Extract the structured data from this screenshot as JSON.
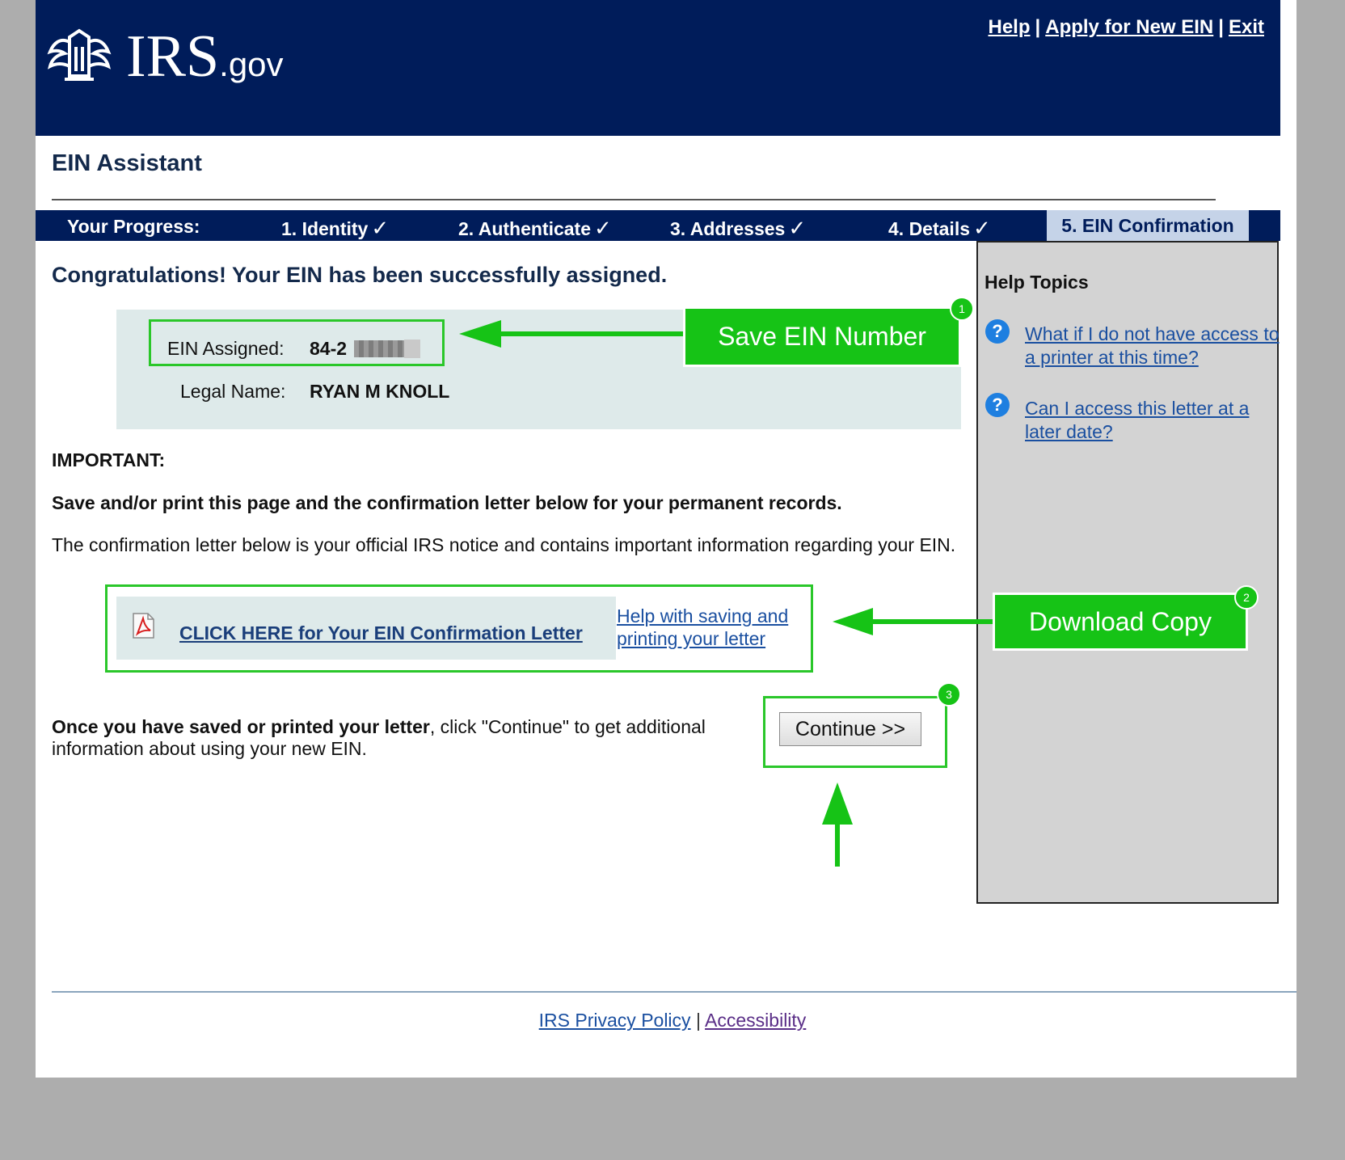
{
  "header": {
    "logo_text": "IRS",
    "logo_suffix": ".gov",
    "links": {
      "help": "Help",
      "apply": "Apply for New EIN",
      "exit": "Exit",
      "separator": "|"
    }
  },
  "app_title": "EIN Assistant",
  "progress": {
    "label": "Your Progress:",
    "steps": [
      {
        "label": "1. Identity",
        "done": true
      },
      {
        "label": "2. Authenticate",
        "done": true
      },
      {
        "label": "3. Addresses",
        "done": true
      },
      {
        "label": "4. Details",
        "done": true
      },
      {
        "label": "5. EIN Confirmation",
        "current": true
      }
    ],
    "check_glyph": "✓"
  },
  "main": {
    "congrats": "Congratulations! Your EIN has been successfully assigned.",
    "ein_label": "EIN Assigned:",
    "ein_value": "84-2",
    "legal_name_label": "Legal Name:",
    "legal_name_value": "RYAN M KNOLL",
    "important": "IMPORTANT:",
    "save_note": "Save and/or print this page and the confirmation letter below for your permanent records.",
    "letter_note": "The confirmation letter below is your official IRS notice and contains important information regarding your EIN.",
    "pdf_link": "CLICK HERE for Your EIN Confirmation Letter",
    "help_saving_link": "Help with saving and printing your letter",
    "continue_bold": "Once you have saved or printed your letter",
    "continue_rest": ", click \"Continue\" to get additional information about using your new EIN.",
    "continue_button": "Continue >>"
  },
  "sidebar": {
    "title": "Help Topics",
    "links": [
      "What if I do not have access to a printer at this time?",
      "Can I access this letter at a later date?"
    ],
    "icon_glyph": "?"
  },
  "annotations": {
    "callout1": "Save EIN Number",
    "callout2": "Download Copy",
    "badge1": "1",
    "badge2": "2",
    "badge3": "3",
    "color": "#16c316"
  },
  "footer": {
    "privacy": "IRS Privacy Policy",
    "separator": "|",
    "accessibility": "Accessibility"
  },
  "colors": {
    "navy": "#001c5a",
    "progress_current_bg": "#c5d3e8",
    "sidebar_bg": "#d3d3d3",
    "info_box_bg": "#deeaea"
  }
}
